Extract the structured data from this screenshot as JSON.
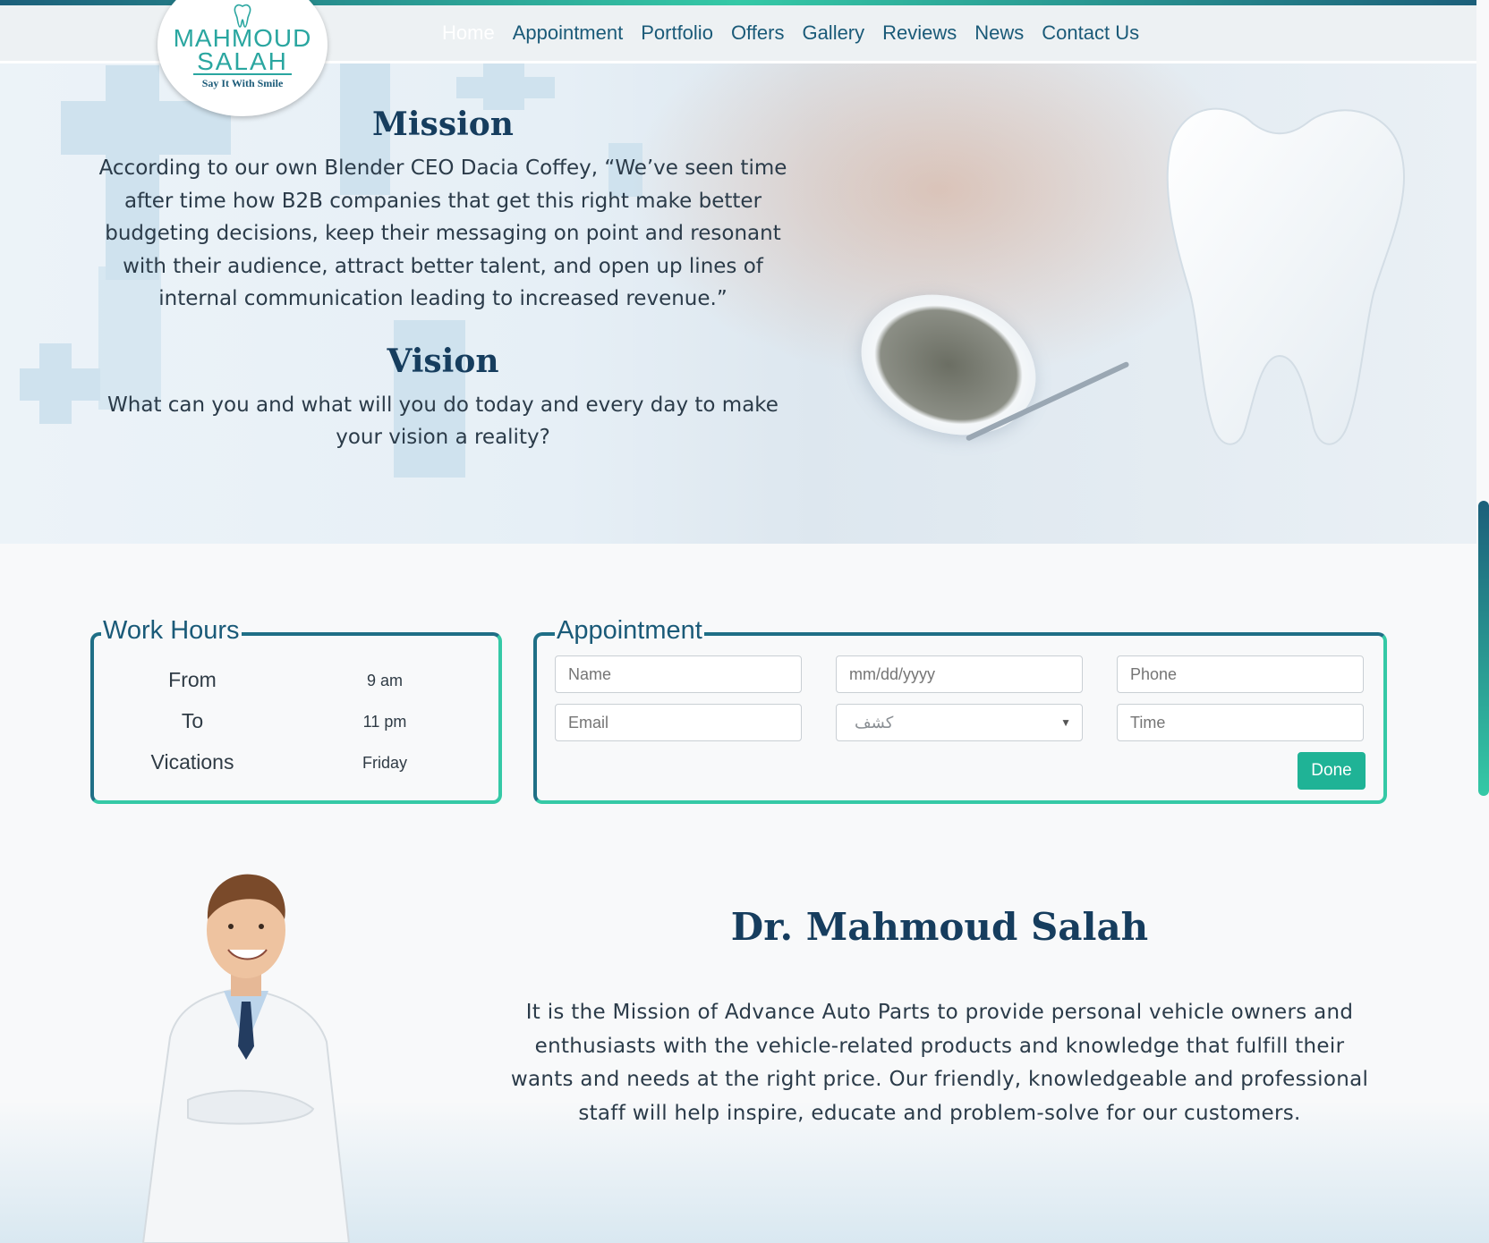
{
  "logo": {
    "line1": "MAHMOUD",
    "line2": "SALAH",
    "tagline": "Say It With Smile"
  },
  "nav": {
    "items": [
      {
        "label": "Home",
        "active": true
      },
      {
        "label": "Appointment"
      },
      {
        "label": "Portfolio"
      },
      {
        "label": "Offers"
      },
      {
        "label": "Gallery"
      },
      {
        "label": "Reviews"
      },
      {
        "label": "News"
      },
      {
        "label": "Contact Us"
      }
    ]
  },
  "hero": {
    "mission_title": "Mission",
    "mission_text": "According to our own Blender CEO Dacia Coffey, “We’ve seen time after time how B2B companies that get this right make better budgeting decisions, keep their messaging on point and resonant with their audience, attract better talent, and open up lines of internal communication leading to increased revenue.”",
    "vision_title": "Vision",
    "vision_text": "What can you and what will you do today and every day to make your vision a reality?"
  },
  "work_hours": {
    "legend": "Work Hours",
    "rows": [
      {
        "label": "From",
        "value": "9 am"
      },
      {
        "label": "To",
        "value": "11 pm"
      },
      {
        "label": "Vications",
        "value": "Friday"
      }
    ]
  },
  "appointment": {
    "legend": "Appointment",
    "name_placeholder": "Name",
    "date_placeholder": "mm/dd/yyyy",
    "phone_placeholder": "Phone",
    "email_placeholder": "Email",
    "select_value": "كشف",
    "time_placeholder": "Time",
    "done_label": "Done"
  },
  "doctor": {
    "name": "Dr. Mahmoud Salah",
    "bio": "It is the Mission of Advance Auto Parts to provide personal vehicle owners and enthusiasts with the vehicle-related products and knowledge that fulfill their wants and needs at the right price. Our friendly, knowledgeable and professional staff will help inspire, educate and problem-solve for our customers."
  },
  "colors": {
    "primary": "#163d5e",
    "nav_text": "#1a5a78",
    "accent": "#35c9a6",
    "button": "#1fb396"
  }
}
